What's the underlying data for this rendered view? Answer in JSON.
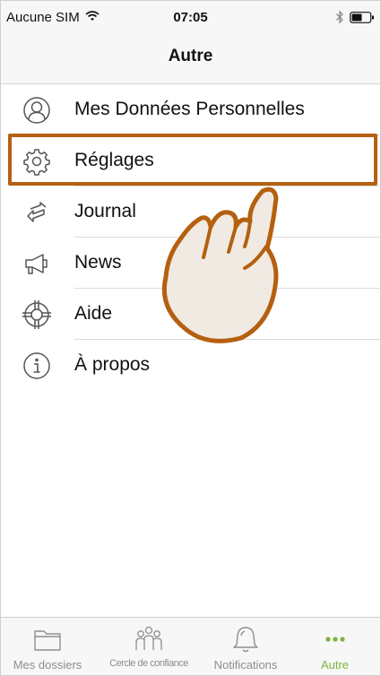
{
  "status_bar": {
    "carrier": "Aucune SIM",
    "time": "07:05"
  },
  "nav": {
    "title": "Autre"
  },
  "menu": {
    "items": [
      {
        "label": "Mes Données Personnelles",
        "icon": "person-circle-icon"
      },
      {
        "label": "Réglages",
        "icon": "gear-icon"
      },
      {
        "label": "Journal",
        "icon": "arrows-exchange-icon"
      },
      {
        "label": "News",
        "icon": "megaphone-icon"
      },
      {
        "label": "Aide",
        "icon": "lifebuoy-icon"
      },
      {
        "label": "À propos",
        "icon": "info-circle-icon"
      }
    ],
    "highlighted_item": "Réglages"
  },
  "tabbar": {
    "tabs": [
      {
        "label": "Mes dossiers",
        "icon": "folder-icon"
      },
      {
        "label": "Cercle de confiance",
        "icon": "group-icon"
      },
      {
        "label": "Notifications",
        "icon": "bell-icon"
      },
      {
        "label": "Autre",
        "icon": "more-dots-icon"
      }
    ],
    "active": "Autre"
  },
  "colors": {
    "highlight": "#b5600f",
    "accent_active_tab": "#7cb33c",
    "icon_gray": "#555555",
    "tab_gray": "#8e8e8e"
  }
}
